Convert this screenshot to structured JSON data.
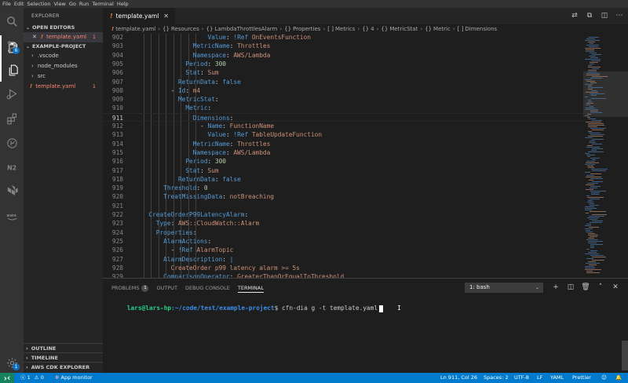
{
  "menubar": [
    "File",
    "Edit",
    "Selection",
    "View",
    "Go",
    "Run",
    "Terminal",
    "Help"
  ],
  "activity": {
    "icons": [
      "files-icon",
      "search-icon",
      "source-control-icon",
      "run-debug-icon",
      "extensions-icon",
      "git-graph-icon",
      "n2-icon",
      "terraform-icon",
      "aws-icon"
    ],
    "scm_badge": "6"
  },
  "sidebar": {
    "title": "EXPLORER",
    "open_editors_header": "OPEN EDITORS",
    "open_editor": {
      "close": "✕",
      "bang": "!",
      "name": "template.yaml",
      "count": "1"
    },
    "project_header": "EXAMPLE-PROJECT",
    "tree": [
      {
        "chevron": "›",
        "name": ".vscode"
      },
      {
        "chevron": "›",
        "name": "node_modules"
      },
      {
        "chevron": "›",
        "name": "src"
      }
    ],
    "yaml_file": {
      "bang": "!",
      "name": "template.yaml",
      "count": "1"
    },
    "bottom_sections": [
      "OUTLINE",
      "TIMELINE",
      "AWS CDK EXPLORER (PRE..."
    ]
  },
  "editor": {
    "tab_label": "template.yaml",
    "tab_bang": "!",
    "breadcrumb": [
      {
        "sym": "!",
        "label": "template.yaml"
      },
      {
        "sym": "{}",
        "label": "Resources"
      },
      {
        "sym": "{}",
        "label": "LambdaThrottlesAlarm"
      },
      {
        "sym": "{}",
        "label": "Properties"
      },
      {
        "sym": "[ ]",
        "label": "Metrics"
      },
      {
        "sym": "{}",
        "label": "4"
      },
      {
        "sym": "{}",
        "label": "MetricStat"
      },
      {
        "sym": "{}",
        "label": "Metric"
      },
      {
        "sym": "[ ]",
        "label": "Dimensions"
      }
    ],
    "lines": [
      {
        "n": "902",
        "segs": [
          [
            "p",
            "                  "
          ],
          [
            "k",
            "Value"
          ],
          [
            "p",
            ": "
          ],
          [
            "k",
            "!Ref"
          ],
          [
            "s",
            " OnEventsFunction"
          ]
        ]
      },
      {
        "n": "903",
        "segs": [
          [
            "p",
            "              "
          ],
          [
            "k",
            "MetricName"
          ],
          [
            "p",
            ": "
          ],
          [
            "s",
            "Throttles"
          ]
        ]
      },
      {
        "n": "904",
        "segs": [
          [
            "p",
            "              "
          ],
          [
            "k",
            "Namespace"
          ],
          [
            "p",
            ": "
          ],
          [
            "s",
            "AWS/Lambda"
          ]
        ]
      },
      {
        "n": "905",
        "segs": [
          [
            "p",
            "            "
          ],
          [
            "k",
            "Period"
          ],
          [
            "p",
            ": "
          ],
          [
            "n",
            "300"
          ]
        ]
      },
      {
        "n": "906",
        "segs": [
          [
            "p",
            "            "
          ],
          [
            "k",
            "Stat"
          ],
          [
            "p",
            ": "
          ],
          [
            "s",
            "Sum"
          ]
        ]
      },
      {
        "n": "907",
        "segs": [
          [
            "p",
            "          "
          ],
          [
            "k",
            "ReturnData"
          ],
          [
            "p",
            ": "
          ],
          [
            "k",
            "false"
          ]
        ]
      },
      {
        "n": "908",
        "segs": [
          [
            "p",
            "        - "
          ],
          [
            "k",
            "Id"
          ],
          [
            "p",
            ": "
          ],
          [
            "s",
            "m4"
          ]
        ]
      },
      {
        "n": "909",
        "segs": [
          [
            "p",
            "          "
          ],
          [
            "k",
            "MetricStat"
          ],
          [
            "p",
            ":"
          ]
        ]
      },
      {
        "n": "910",
        "segs": [
          [
            "p",
            "            "
          ],
          [
            "k",
            "Metric"
          ],
          [
            "p",
            ":"
          ]
        ]
      },
      {
        "n": "911",
        "segs": [
          [
            "p",
            "              "
          ],
          [
            "k",
            "Dimensions"
          ],
          [
            "p",
            ":"
          ]
        ]
      },
      {
        "n": "912",
        "segs": [
          [
            "p",
            "                - "
          ],
          [
            "k",
            "Name"
          ],
          [
            "p",
            ": "
          ],
          [
            "s",
            "FunctionName"
          ]
        ]
      },
      {
        "n": "913",
        "segs": [
          [
            "p",
            "                  "
          ],
          [
            "k",
            "Value"
          ],
          [
            "p",
            ": "
          ],
          [
            "k",
            "!Ref"
          ],
          [
            "s",
            " TableUpdateFunction"
          ]
        ]
      },
      {
        "n": "914",
        "segs": [
          [
            "p",
            "              "
          ],
          [
            "k",
            "MetricName"
          ],
          [
            "p",
            ": "
          ],
          [
            "s",
            "Throttles"
          ]
        ]
      },
      {
        "n": "915",
        "segs": [
          [
            "p",
            "              "
          ],
          [
            "k",
            "Namespace"
          ],
          [
            "p",
            ": "
          ],
          [
            "s",
            "AWS/Lambda"
          ]
        ]
      },
      {
        "n": "916",
        "segs": [
          [
            "p",
            "            "
          ],
          [
            "k",
            "Period"
          ],
          [
            "p",
            ": "
          ],
          [
            "n",
            "300"
          ]
        ]
      },
      {
        "n": "917",
        "segs": [
          [
            "p",
            "            "
          ],
          [
            "k",
            "Stat"
          ],
          [
            "p",
            ": "
          ],
          [
            "s",
            "Sum"
          ]
        ]
      },
      {
        "n": "918",
        "segs": [
          [
            "p",
            "          "
          ],
          [
            "k",
            "ReturnData"
          ],
          [
            "p",
            ": "
          ],
          [
            "k",
            "false"
          ]
        ]
      },
      {
        "n": "919",
        "segs": [
          [
            "p",
            "      "
          ],
          [
            "k",
            "Threshold"
          ],
          [
            "p",
            ": "
          ],
          [
            "n",
            "0"
          ]
        ]
      },
      {
        "n": "920",
        "segs": [
          [
            "p",
            "      "
          ],
          [
            "k",
            "TreatMissingData"
          ],
          [
            "p",
            ": "
          ],
          [
            "s",
            "notBreaching"
          ]
        ]
      },
      {
        "n": "921",
        "segs": []
      },
      {
        "n": "922",
        "segs": [
          [
            "p",
            "  "
          ],
          [
            "k",
            "CreateOrderP99LatencyAlarm"
          ],
          [
            "p",
            ":"
          ]
        ]
      },
      {
        "n": "923",
        "segs": [
          [
            "p",
            "    "
          ],
          [
            "k",
            "Type"
          ],
          [
            "p",
            ": "
          ],
          [
            "s",
            "AWS::CloudWatch::Alarm"
          ]
        ]
      },
      {
        "n": "924",
        "segs": [
          [
            "p",
            "    "
          ],
          [
            "k",
            "Properties"
          ],
          [
            "p",
            ":"
          ]
        ]
      },
      {
        "n": "925",
        "segs": [
          [
            "p",
            "      "
          ],
          [
            "k",
            "AlarmActions"
          ],
          [
            "p",
            ":"
          ]
        ]
      },
      {
        "n": "926",
        "segs": [
          [
            "p",
            "        - "
          ],
          [
            "k",
            "!Ref"
          ],
          [
            "s",
            " AlarmTopic"
          ]
        ]
      },
      {
        "n": "927",
        "segs": [
          [
            "p",
            "      "
          ],
          [
            "k",
            "AlarmDescription"
          ],
          [
            "p",
            ": "
          ],
          [
            "k",
            "|"
          ]
        ]
      },
      {
        "n": "928",
        "segs": [
          [
            "p",
            "        "
          ],
          [
            "s",
            "CreateOrder p99 latency alarm >= 5s"
          ]
        ]
      },
      {
        "n": "929",
        "segs": [
          [
            "p",
            "      "
          ],
          [
            "k",
            "ComparisonOperator"
          ],
          [
            "p",
            ": "
          ],
          [
            "s",
            "GreaterThanOrEqualToThreshold"
          ]
        ]
      }
    ],
    "active_line": "911"
  },
  "panel": {
    "tabs": [
      {
        "label": "PROBLEMS",
        "badge": "1"
      },
      {
        "label": "OUTPUT"
      },
      {
        "label": "DEBUG CONSOLE"
      },
      {
        "label": "TERMINAL",
        "active": true
      }
    ],
    "terminal_select": "1: bash",
    "terminal": {
      "user": "lars@lars-hp",
      "path": ":~/code/test/example-project",
      "prompt_end": "$",
      "command": " cfn-dia g -t template.yaml"
    }
  },
  "statusbar": {
    "errors": "1",
    "warnings": "0",
    "app_monitor": "App monitor",
    "position": "Ln 911, Col 26",
    "spaces": "Spaces: 2",
    "encoding": "UTF-8",
    "eol": "LF",
    "language": "YAML",
    "formatter": "Prettier"
  }
}
